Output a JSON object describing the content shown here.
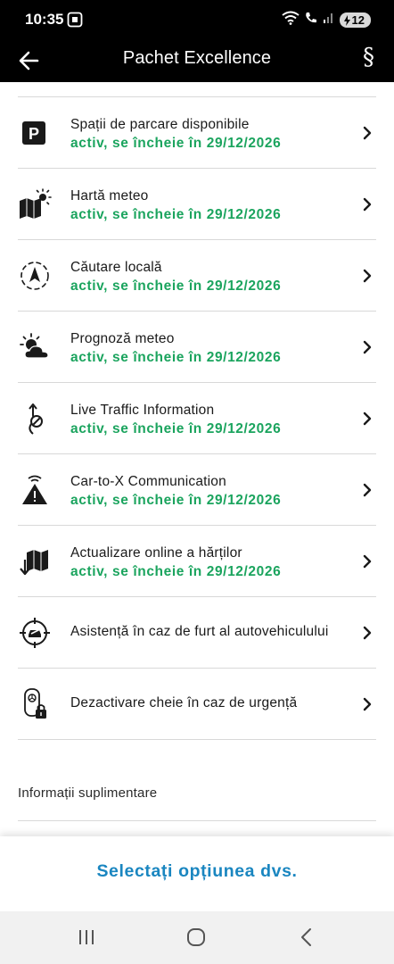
{
  "status_bar": {
    "time": "10:35",
    "battery": "12",
    "icons": [
      "screenshot-icon",
      "wifi-icon",
      "wifi-call-icon",
      "signal-icon",
      "battery-charging-icon"
    ]
  },
  "app_bar": {
    "title": "Pachet Excellence",
    "back_icon": "arrow-left-icon",
    "legal_symbol": "§"
  },
  "items": [
    {
      "label": "Spații de parcare disponibile",
      "status": "activ, se încheie în 29/12/2026",
      "icon": "parking-icon"
    },
    {
      "label": "Hartă meteo",
      "status": "activ, se încheie în 29/12/2026",
      "icon": "weather-map-icon"
    },
    {
      "label": "Căutare locală",
      "status": "activ, se încheie în 29/12/2026",
      "icon": "compass-icon"
    },
    {
      "label": "Prognoză meteo",
      "status": "activ, se încheie în 29/12/2026",
      "icon": "weather-forecast-icon"
    },
    {
      "label": "Live Traffic Information",
      "status": "activ, se încheie în 29/12/2026",
      "icon": "traffic-info-icon"
    },
    {
      "label": "Car-to-X Communication",
      "status": "activ, se încheie în 29/12/2026",
      "icon": "warning-signal-icon"
    },
    {
      "label": "Actualizare online a hărților",
      "status": "activ, se încheie în 29/12/2026",
      "icon": "map-download-icon"
    },
    {
      "label": "Asistență în caz de furt al autovehiculului",
      "icon": "theft-assist-icon"
    },
    {
      "label": "Dezactivare cheie în caz de urgență",
      "icon": "key-lock-icon"
    }
  ],
  "extra_info_label": "Informații suplimentare",
  "select_button_label": "Selectați opțiunea dvs.",
  "colors": {
    "status_green": "#1ba45e",
    "accent_blue": "#1a86c0",
    "bar_black": "#000000"
  },
  "nav": {
    "icons": [
      "recent-apps-icon",
      "home-icon",
      "back-nav-icon"
    ]
  }
}
